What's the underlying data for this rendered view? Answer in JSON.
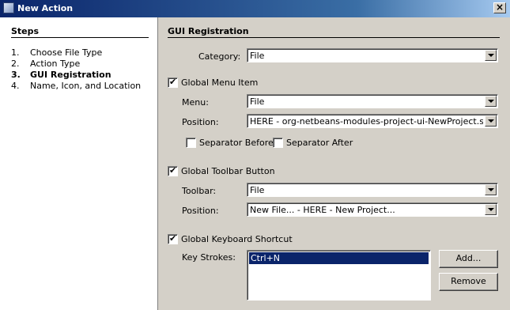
{
  "window": {
    "title": "New Action",
    "close_symbol": "×"
  },
  "steps": {
    "title": "Steps",
    "items": [
      {
        "num": "1.",
        "label": "Choose File Type"
      },
      {
        "num": "2.",
        "label": "Action Type"
      },
      {
        "num": "3.",
        "label": "GUI Registration"
      },
      {
        "num": "4.",
        "label": "Name, Icon, and Location"
      }
    ]
  },
  "main": {
    "title": "GUI Registration",
    "category": {
      "label": "Category:",
      "value": "File"
    },
    "global_menu": {
      "label": "Global Menu Item",
      "checked": true,
      "menu": {
        "label": "Menu:",
        "value": "File"
      },
      "position": {
        "label": "Position:",
        "value": "HERE - org-netbeans-modules-project-ui-NewProject.shadow"
      },
      "separator_before": {
        "label": "Separator Before",
        "checked": false
      },
      "separator_after": {
        "label": "Separator After",
        "checked": false
      }
    },
    "global_toolbar": {
      "label": "Global Toolbar Button",
      "checked": true,
      "toolbar": {
        "label": "Toolbar:",
        "value": "File"
      },
      "position": {
        "label": "Position:",
        "value": "New File... - HERE - New Project..."
      }
    },
    "global_keyboard": {
      "label": "Global Keyboard Shortcut",
      "checked": true,
      "key_strokes": {
        "label": "Key Strokes:",
        "items": [
          "Ctrl+N"
        ]
      },
      "add_label": "Add...",
      "remove_label": "Remove"
    }
  }
}
